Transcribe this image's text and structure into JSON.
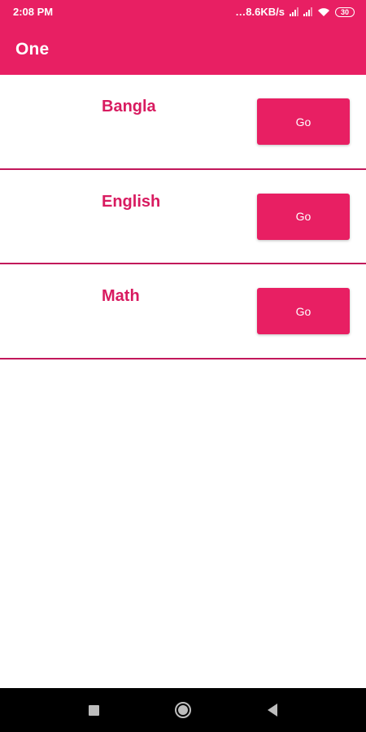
{
  "status_bar": {
    "time": "2:08 PM",
    "network_speed": "…8.6KB/s",
    "battery": "30",
    "icons": [
      "signal-icon",
      "signal-icon",
      "wifi-icon",
      "battery-icon"
    ]
  },
  "app_bar": {
    "title": "One"
  },
  "subjects": [
    {
      "label": "Bangla",
      "button_label": "Go"
    },
    {
      "label": "English",
      "button_label": "Go"
    },
    {
      "label": "Math",
      "button_label": "Go"
    }
  ],
  "nav_bar": {
    "icons": [
      "recents-icon",
      "home-icon",
      "back-icon"
    ]
  },
  "colors": {
    "primary": "#e81f63",
    "label_text": "#d81b60",
    "divider": "#c2185b",
    "nav_background": "#000000"
  }
}
